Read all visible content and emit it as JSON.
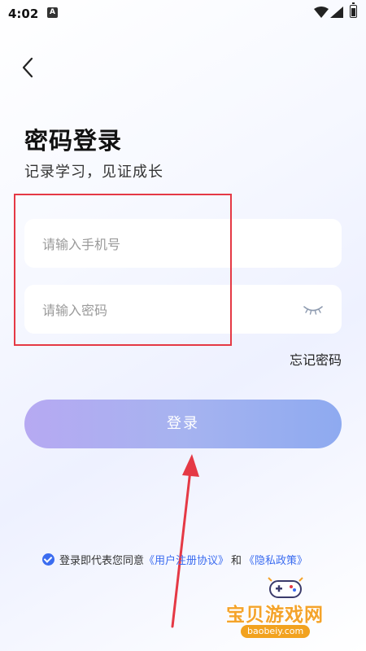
{
  "status_bar": {
    "time": "4:02",
    "notification_letter": "A"
  },
  "header": {
    "back_icon": "chevron-left-icon"
  },
  "title": "密码登录",
  "subtitle": "记录学习，见证成长",
  "form": {
    "phone_placeholder": "请输入手机号",
    "phone_value": "",
    "password_placeholder": "请输入密码",
    "password_value": "",
    "eye_icon": "eye-closed-icon",
    "forgot_label": "忘记密码",
    "login_label": "登录"
  },
  "agreement": {
    "checked": true,
    "text_prefix": "登录即代表您同意",
    "user_agreement": "《用户注册协议》",
    "conjunction": "和",
    "privacy_policy": "《隐私政策》"
  },
  "annotations": {
    "highlight_color": "#e53945",
    "arrow_color": "#e53945"
  },
  "watermark": {
    "text": "宝贝游戏网",
    "url": "baobeiy.com"
  },
  "colors": {
    "accent": "#3b6cf0",
    "button_start": "#b6a9f2",
    "button_end": "#8eaaf0"
  }
}
